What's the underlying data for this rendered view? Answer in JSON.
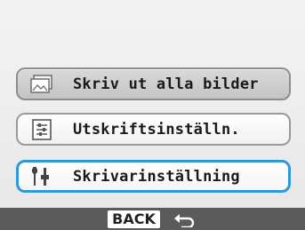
{
  "menu": {
    "items": [
      {
        "label": "Skriv ut alla bilder",
        "icon": "print-all-images-icon",
        "state": "normal"
      },
      {
        "label": "Utskriftsinställn.",
        "icon": "print-settings-icon",
        "state": "normal"
      },
      {
        "label": "Skrivarinställning",
        "icon": "printer-settings-icon",
        "state": "selected"
      }
    ]
  },
  "footer": {
    "back_label": "BACK",
    "return_icon": "return-arrow-icon"
  },
  "colors": {
    "selection_border": "#2f98d6",
    "footer_bg": "#5a5a5a"
  }
}
